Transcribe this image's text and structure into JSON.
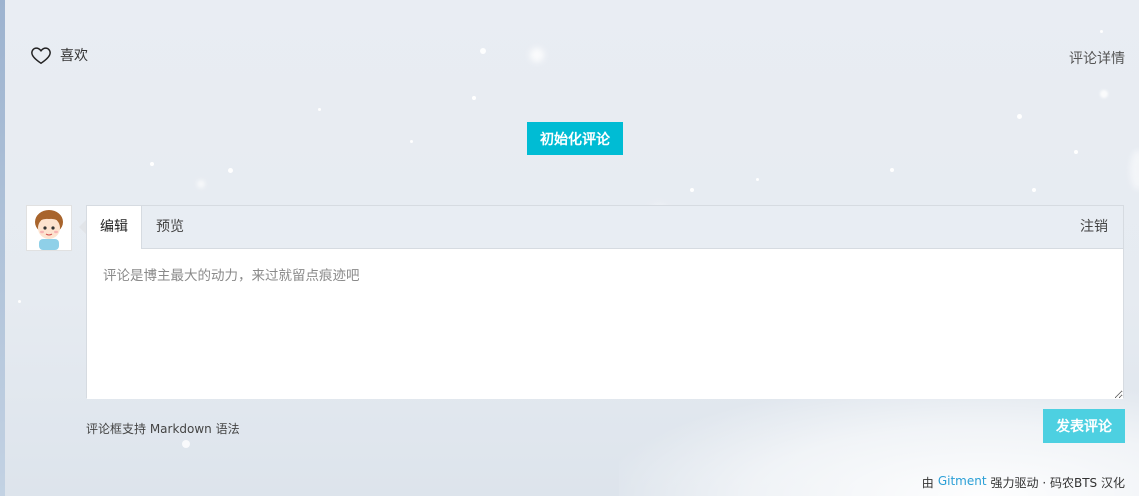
{
  "header": {
    "like_label": "喜欢",
    "details_link": "评论详情"
  },
  "init_button": "初始化评论",
  "editor": {
    "tabs": [
      {
        "label": "编辑",
        "active": true
      },
      {
        "label": "预览",
        "active": false
      }
    ],
    "logout_label": "注销",
    "placeholder": "评论是博主最大的动力，来过就留点痕迹吧",
    "value": ""
  },
  "markdown_tip": "评论框支持 Markdown 语法",
  "submit_button": "发表评论",
  "footer": {
    "prefix": "由",
    "link": "Gitment",
    "middle": "强力驱动 · 码农BTS 汉化"
  },
  "colors": {
    "accent": "#00bcd4",
    "submit": "#4dd0e1",
    "link": "#2a9fd6"
  },
  "icons": [
    "heart-icon",
    "avatar"
  ]
}
